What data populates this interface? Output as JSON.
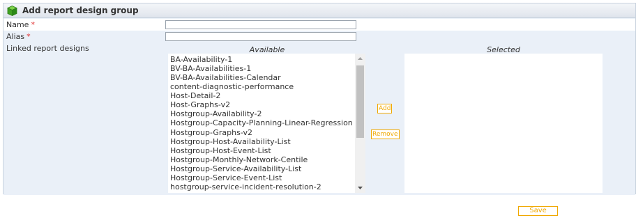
{
  "header": {
    "title": "Add report design group",
    "icon": "green-cube-icon"
  },
  "form": {
    "name_label": "Name",
    "name_value": "",
    "alias_label": "Alias",
    "alias_value": "",
    "required_mark": "*",
    "linked_label": "Linked report designs"
  },
  "linked": {
    "available_header": "Available",
    "selected_header": "Selected",
    "available_items": [
      "BA-Availability-1",
      "BV-BA-Availabilities-1",
      "BV-BA-Availabilities-Calendar",
      "content-diagnostic-performance",
      "Host-Detail-2",
      "Host-Graphs-v2",
      "Hostgroup-Availability-2",
      "Hostgroup-Capacity-Planning-Linear-Regression",
      "Hostgroup-Graphs-v2",
      "Hostgroup-Host-Availability-List",
      "Hostgroup-Host-Event-List",
      "Hostgroup-Monthly-Network-Centile",
      "Hostgroup-Service-Availability-List",
      "Hostgroup-Service-Event-List",
      "hostgroup-service-incident-resolution-2"
    ],
    "selected_items": [],
    "add_label": "Add",
    "remove_label": "Remove"
  },
  "actions": {
    "save_label": "Save"
  },
  "colors": {
    "accent": "#f0a800",
    "required": "#e03030",
    "panel_bg": "#eaf0f8"
  }
}
